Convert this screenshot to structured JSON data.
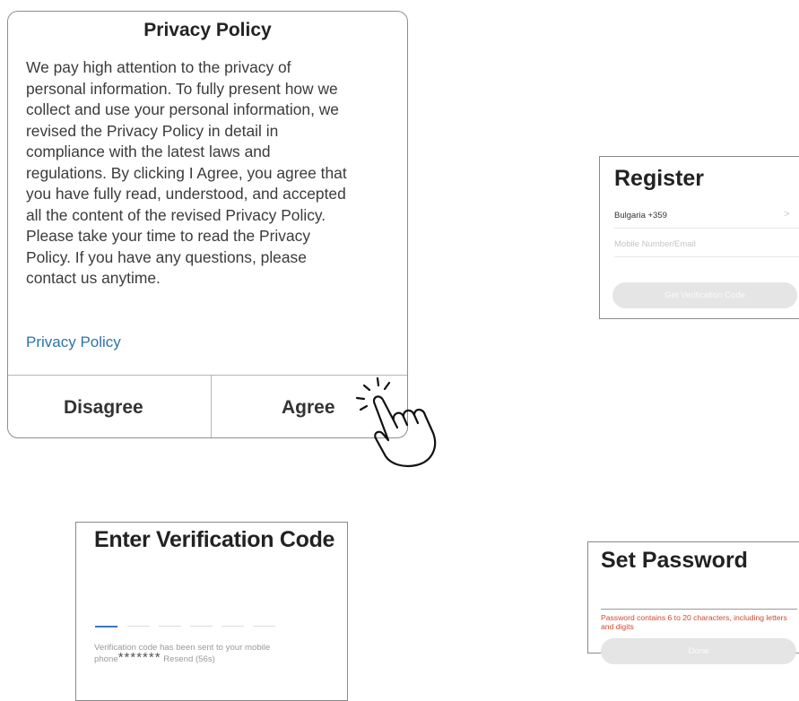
{
  "privacy_dialog": {
    "title": "Privacy Policy",
    "body_lines": [
      "We pay high attention to the privacy of",
      "personal information. To fully present how we",
      "collect and use your personal information, we",
      "revised the Privacy Policy in detail in",
      "compliance with the latest laws and",
      "regulations. By clicking I Agree, you agree that",
      "you have fully read, understood, and accepted",
      "all the content of the revised Privacy Policy.",
      "Please take your time to read the Privacy",
      "Policy. If you have any questions, please",
      "contact us anytime."
    ],
    "link_label": "Privacy Policy",
    "disagree_label": "Disagree",
    "agree_label": "Agree"
  },
  "register": {
    "title": "Register",
    "country": "Bulgaria +359",
    "chevron": ">",
    "mobile_placeholder": "Mobile Number/Email",
    "button_label": "Get Verification Code"
  },
  "verification": {
    "title": "Enter Verification Code",
    "message": "Verification code has been sent to your mobile",
    "phone_prefix": "phone",
    "masked_number": "*******",
    "resend_label": "Resend (56s)",
    "code_slots": 6,
    "active_slot_color": "#3b78c8"
  },
  "set_password": {
    "title": "Set Password",
    "error": "Password contains 6 to 20 characters, including letters and digits",
    "error_color": "#d2482f",
    "button_label": "Done"
  },
  "icons": {
    "tap_hand": "hand-pointer-icon"
  }
}
